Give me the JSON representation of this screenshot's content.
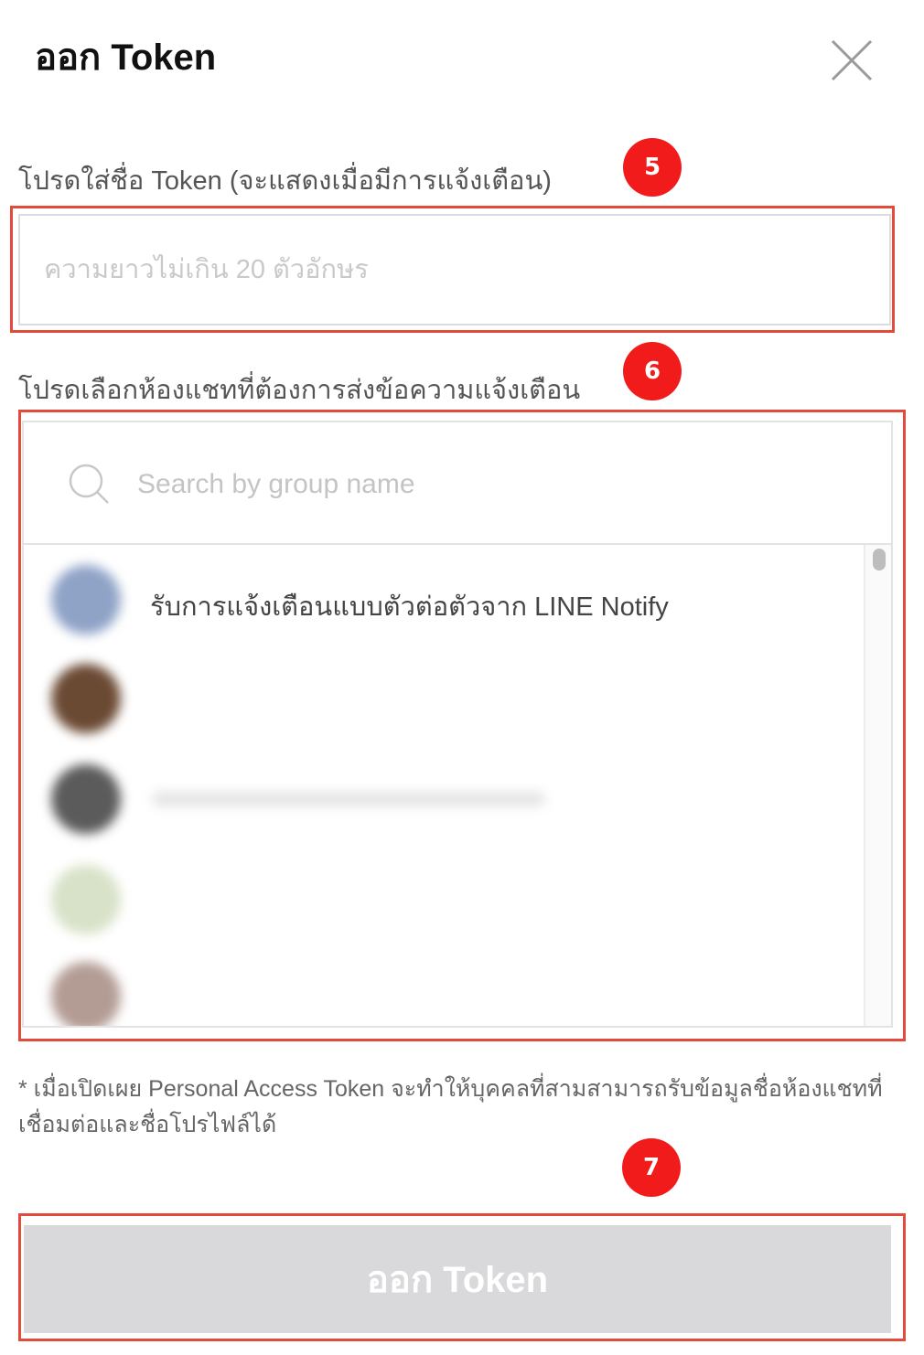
{
  "dialog": {
    "title": "ออก Token",
    "close_icon": "close-icon"
  },
  "token_name": {
    "label": "โปรดใส่ชื่อ Token (จะแสดงเมื่อมีการแจ้งเตือน)",
    "placeholder": "ความยาวไม่เกิน 20 ตัวอักษร",
    "value": ""
  },
  "chat_select": {
    "label": "โปรดเลือกห้องแชทที่ต้องการส่งข้อความแจ้งเตือน",
    "search_placeholder": "Search by group name",
    "search_icon": "search-icon",
    "items": [
      {
        "name": "รับการแจ้งเตือนแบบตัวต่อตัวจาก LINE Notify",
        "avatar_color": "#8fa3c7"
      },
      {
        "name": "",
        "avatar_color": "#6b4a34"
      },
      {
        "name": "",
        "avatar_color": "#5b5b5b"
      },
      {
        "name": "",
        "avatar_color": "#d8e2c8"
      },
      {
        "name": "",
        "avatar_color": "#b39c94"
      }
    ]
  },
  "note": "* เมื่อเปิดเผย Personal Access Token จะทำให้บุคคลที่สามสามารถรับข้อมูลชื่อห้องแชทที่เชื่อมต่อและชื่อโปรไฟล์ได้",
  "issue_button": {
    "label": "ออก Token"
  },
  "annotations": {
    "badges": [
      "5",
      "6",
      "7"
    ],
    "highlight_color": "#e24b3b",
    "badge_color": "#f21b1b"
  }
}
